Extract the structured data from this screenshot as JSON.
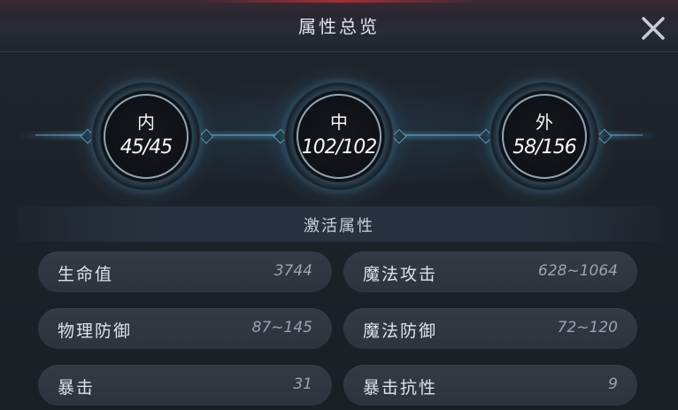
{
  "header": {
    "title": "属性总览"
  },
  "close": {
    "icon": "close-icon"
  },
  "orbs": [
    {
      "label": "内",
      "value": "45/45"
    },
    {
      "label": "中",
      "value": "102/102"
    },
    {
      "label": "外",
      "value": "58/156"
    }
  ],
  "section": {
    "title": "激活属性"
  },
  "stats": [
    {
      "name": "生命值",
      "value": "3744"
    },
    {
      "name": "魔法攻击",
      "value": "628~1064"
    },
    {
      "name": "物理防御",
      "value": "87~145"
    },
    {
      "name": "魔法防御",
      "value": "72~120"
    },
    {
      "name": "暴击",
      "value": "31"
    },
    {
      "name": "暴击抗性",
      "value": "9"
    }
  ],
  "colors": {
    "accent_glow": "#50a0c8",
    "header_red": "#aa323c",
    "panel_bg": "#1b2027"
  }
}
